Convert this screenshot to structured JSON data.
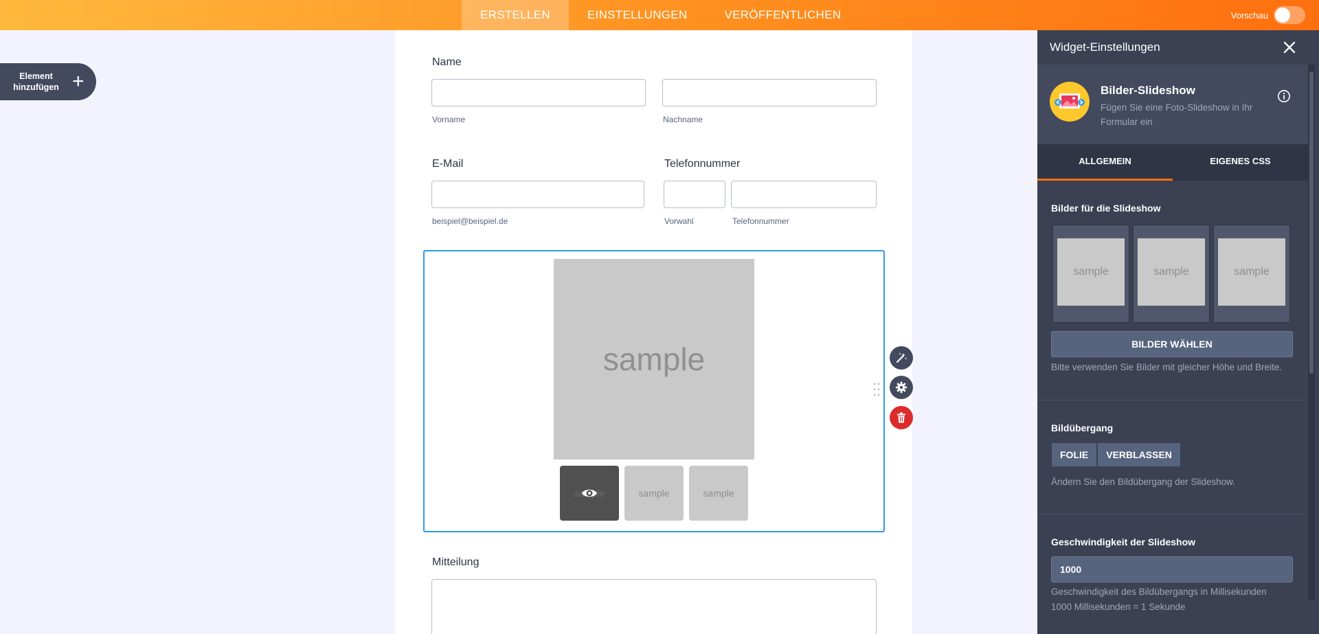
{
  "topbar": {
    "tabs": [
      {
        "label": "ERSTELLEN",
        "active": true
      },
      {
        "label": "EINSTELLUNGEN",
        "active": false
      },
      {
        "label": "VERÖFFENTLICHEN",
        "active": false
      }
    ],
    "preview_label": "Vorschau",
    "preview_enabled": false
  },
  "add_element": {
    "label_line1": "Element",
    "label_line2": "hinzufügen",
    "icon": "plus-icon"
  },
  "form": {
    "name": {
      "label": "Name",
      "first_sub": "Vorname",
      "last_sub": "Nachname",
      "first_value": "",
      "last_value": ""
    },
    "email": {
      "label": "E-Mail",
      "sub": "beispiel@beispiel.de",
      "value": ""
    },
    "phone": {
      "label": "Telefonnummer",
      "area_sub": "Vorwahl",
      "number_sub": "Telefonnummer",
      "area_value": "",
      "number_value": ""
    },
    "slideshow": {
      "main_text": "sample",
      "thumbs": [
        "sample",
        "sample",
        "sample"
      ],
      "active_thumb": 0
    },
    "side_actions": [
      "wand-icon",
      "gear-icon",
      "trash-icon"
    ],
    "message": {
      "label": "Mitteilung",
      "value": ""
    }
  },
  "panel": {
    "title": "Widget-Einstellungen",
    "widget": {
      "name": "Bilder-Slideshow",
      "description": "Fügen Sie eine Foto-Slideshow in Ihr Formular ein",
      "icon": "slideshow-logo-icon"
    },
    "tabs": [
      {
        "label": "ALLGEMEIN",
        "active": true
      },
      {
        "label": "EIGENES CSS",
        "active": false
      }
    ],
    "images": {
      "title": "Bilder für die Slideshow",
      "items": [
        "sample",
        "sample",
        "sample"
      ],
      "button": "BILDER WÄHLEN",
      "hint": "Bitte verwenden Sie Bilder mit gleicher Höhe und Breite."
    },
    "transition": {
      "title": "Bildübergang",
      "options": [
        "FOLIE",
        "VERBLASSEN"
      ],
      "hint": "Ändern Sie den Bildübergang der Slideshow."
    },
    "speed": {
      "title": "Geschwindigkeit der Slideshow",
      "value": "1000",
      "hint1": "Geschwindigkeit des Bildübergangs in Millisekunden",
      "hint2": "1000 Millisekunden = 1 Sekunde"
    }
  },
  "colors": {
    "accent": "#ff6f0f",
    "selection": "#2f9be8",
    "panel": "#3b4153",
    "danger": "#dc2b2b"
  }
}
